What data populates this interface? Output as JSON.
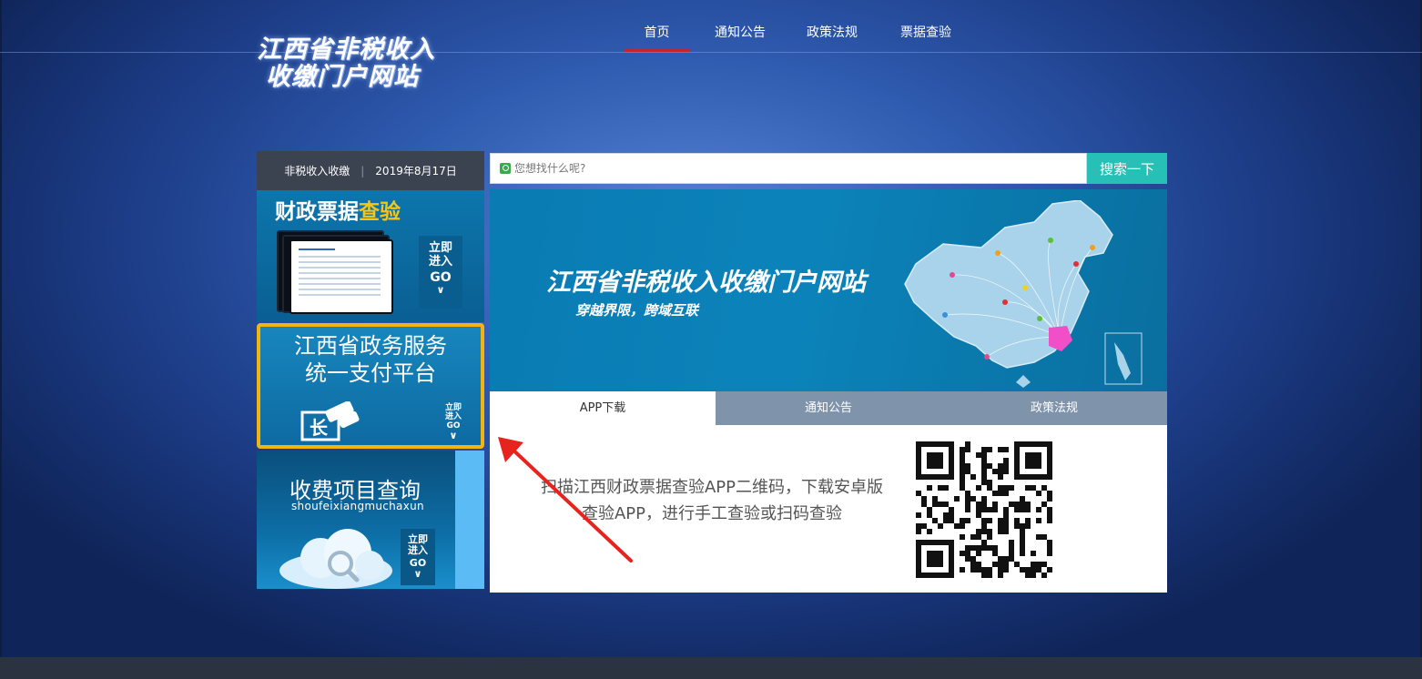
{
  "header": {
    "logo_line1": "江西省非税收入",
    "logo_line2": "收缴门户网站",
    "nav": [
      {
        "label": "首页",
        "active": true
      },
      {
        "label": "通知公告",
        "active": false
      },
      {
        "label": "政策法规",
        "active": false
      },
      {
        "label": "票据查验",
        "active": false
      }
    ]
  },
  "sidebar": {
    "date_bar": {
      "left": "非税收入收缴",
      "separator": "|",
      "date": "2019年8月17日"
    },
    "card_invoice": {
      "title_main": "财政票据",
      "title_highlight": "查验",
      "go_line1": "立即",
      "go_line2": "进入",
      "go_line3": "GO",
      "chevron": "∨"
    },
    "card_payment": {
      "title_line1": "江西省政务服务",
      "title_line2": "统一支付平台",
      "go_line1": "立即",
      "go_line2": "进入",
      "go_line3": "GO",
      "chevron": "∨"
    },
    "card_fees": {
      "title": "收费项目查询",
      "subtitle": "shoufeixiangmuchaxun",
      "go_line1": "立即",
      "go_line2": "进入",
      "go_line3": "GO",
      "chevron": "∨"
    }
  },
  "search": {
    "placeholder": "您想找什么呢?",
    "button_label": "搜索一下"
  },
  "banner": {
    "title": "江西省非税收入收缴门户网站",
    "subtitle": "穿越界限，跨域互联"
  },
  "tabs": [
    {
      "label": "APP下载",
      "active": true
    },
    {
      "label": "通知公告",
      "active": false
    },
    {
      "label": "政策法规",
      "active": false
    }
  ],
  "app_panel": {
    "text": "扫描江西财政票据查验APP二维码，下载安卓版查验APP，进行手工查验或扫码查验"
  },
  "colors": {
    "accent_teal": "#27c0b7",
    "nav_active": "#c0262e",
    "highlight_yellow": "#f5c518",
    "card_border": "#f2b411",
    "arrow_red": "#e8231e"
  }
}
